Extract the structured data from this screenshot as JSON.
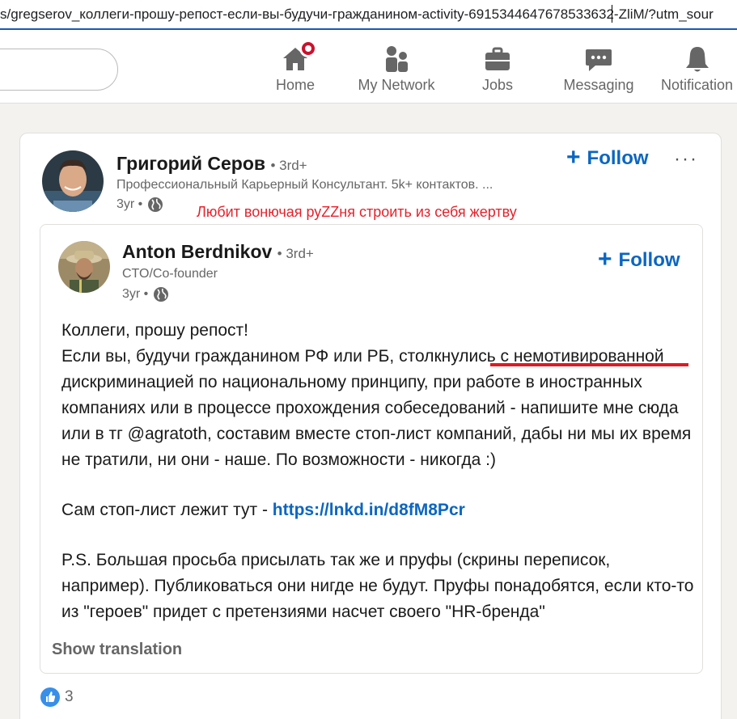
{
  "browser": {
    "url": "s/gregserov_коллеги-прошу-репост-если-вы-будучи-гражданином-activity-6915344647678533632-ZliM/?utm_sour"
  },
  "nav": {
    "items": [
      {
        "label": "Home",
        "icon": "home-icon"
      },
      {
        "label": "My Network",
        "icon": "network-icon"
      },
      {
        "label": "Jobs",
        "icon": "briefcase-icon"
      },
      {
        "label": "Messaging",
        "icon": "messaging-icon"
      },
      {
        "label": "Notification",
        "icon": "bell-icon"
      }
    ]
  },
  "post": {
    "author": {
      "name": "Григорий Серов",
      "degree": "• 3rd+",
      "headline": "Профессиональный Карьерный Консультант. 5k+ контактов. ...",
      "time": "3yr •"
    },
    "follow_label": "Follow",
    "more_label": "···",
    "annotation": "Любит вонючая руZZня строить из себя жертву",
    "shared": {
      "author": {
        "name": "Anton Berdnikov",
        "degree": "• 3rd+",
        "headline": "CTO/Co-founder",
        "time": "3yr •"
      },
      "follow_label": "Follow",
      "paragraph1_line1": "Коллеги, прошу репост!",
      "paragraph1_line2": "Если вы, будучи гражданином РФ или РБ, столкнулись с немотивированной дискриминацией по национальному принципу, при работе в иностранных компаниях или в процессе прохождения собеседований - напишите мне сюда или в тг @agratoth, составим вместе стоп-лист компаний, дабы ни мы их время не тратили, ни они - наше. По возможности - никогда :)",
      "paragraph2_prefix": "Сам стоп-лист лежит тут - ",
      "paragraph2_link": "https://lnkd.in/d8fM8Pcr",
      "paragraph3": "P.S. Большая просьба присылать так же и пруфы (скрины переписок, например). Публиковаться они нигде не будут. Пруфы понадобятся, если кто-то из \"героев\" придет с претензиями насчет своего \"HR-бренда\"",
      "show_translation": "Show translation"
    },
    "reactions_count": "3"
  },
  "colors": {
    "accent": "#0a66c2",
    "annotation": "#e8202a",
    "notification_badge": "#cb112d"
  }
}
